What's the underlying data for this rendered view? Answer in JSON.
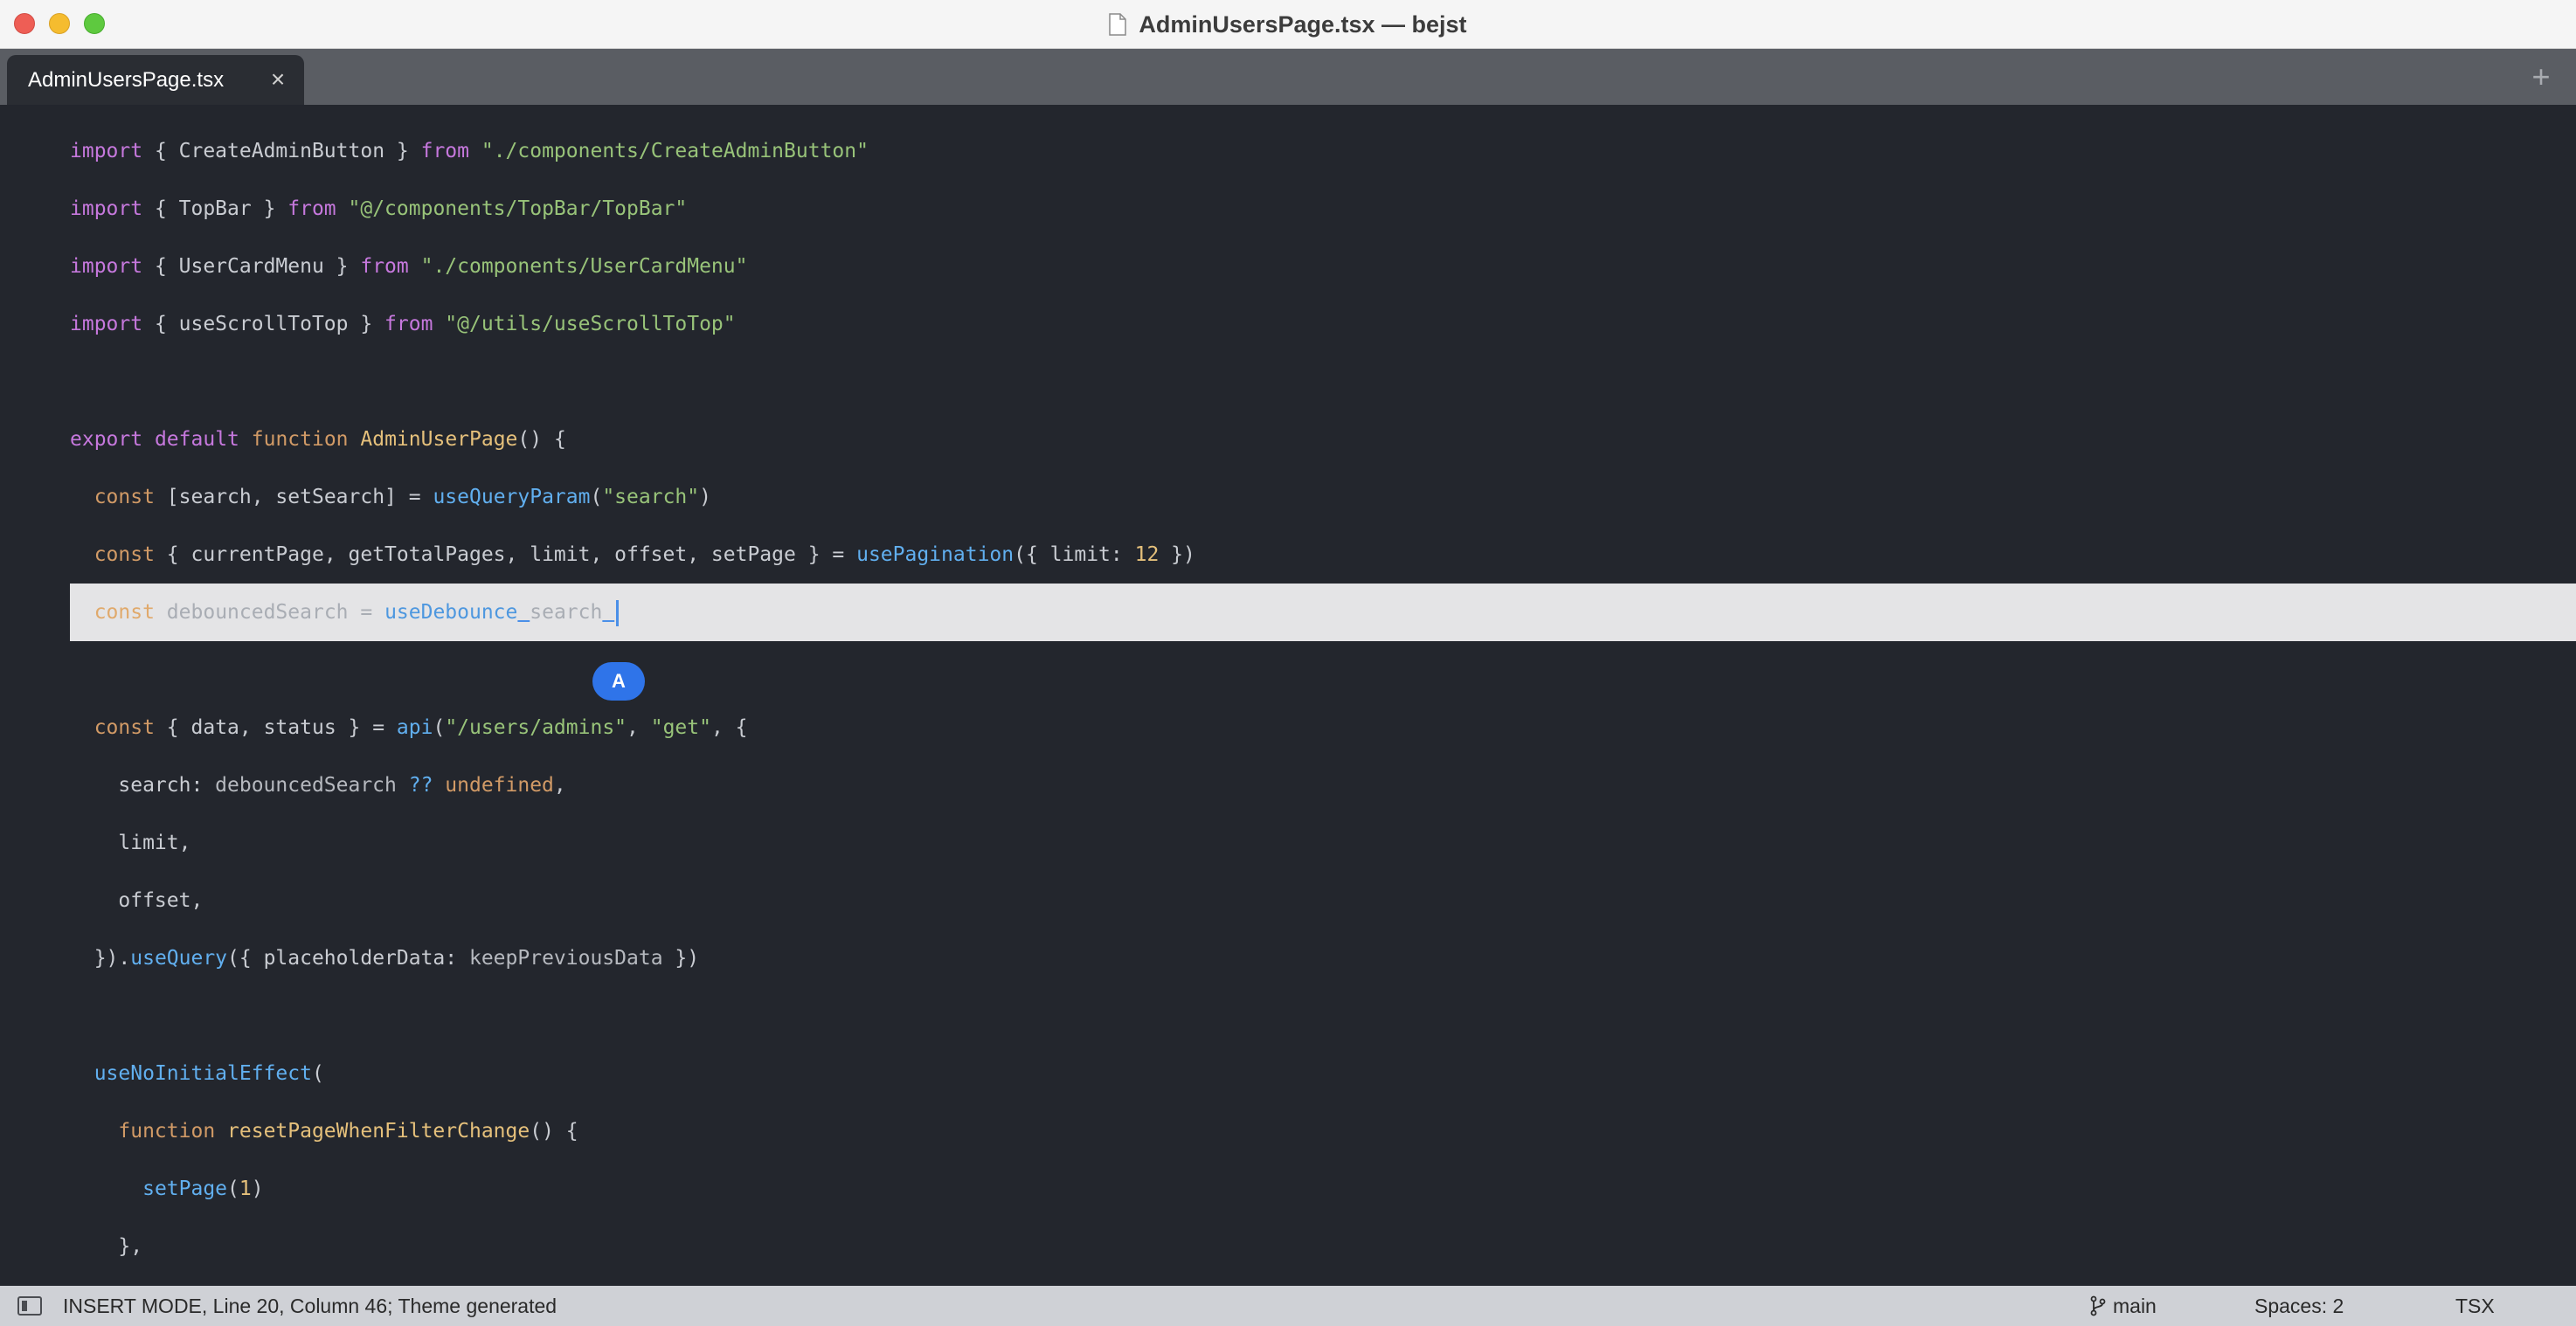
{
  "window": {
    "title": "AdminUsersPage.tsx — bejst"
  },
  "tabs": [
    {
      "label": "AdminUsersPage.tsx",
      "close_glyph": "×"
    }
  ],
  "new_tab_glyph": "+",
  "editor": {
    "lines": [
      {
        "parts": [
          "import",
          " { CreateAdminButton } ",
          "from",
          " ",
          "\"./components/CreateAdminButton\""
        ]
      },
      {
        "parts": [
          "import",
          " { TopBar } ",
          "from",
          " ",
          "\"@/components/TopBar/TopBar\""
        ]
      },
      {
        "parts": [
          "import",
          " { UserCardMenu } ",
          "from",
          " ",
          "\"./components/UserCardMenu\""
        ]
      },
      {
        "parts": [
          "import",
          " { useScrollToTop } ",
          "from",
          " ",
          "\"@/utils/useScrollToTop\""
        ]
      },
      {
        "parts": []
      },
      {
        "parts": [
          "export",
          " ",
          "default",
          " ",
          "function",
          " ",
          "AdminUserPage",
          "() {"
        ]
      },
      {
        "parts": [
          "  ",
          "const",
          " [search, setSearch] = ",
          "useQueryParam",
          "(",
          "\"search\"",
          ")"
        ]
      },
      {
        "parts": [
          "  ",
          "const",
          " { currentPage, getTotalPages, limit, offset, setPage } = ",
          "usePagination",
          "({ limit: ",
          "12",
          " })"
        ]
      },
      {
        "parts": [
          "  ",
          "const",
          " debouncedSearch = ",
          "useDebounce",
          " ",
          "search",
          " "
        ]
      },
      {
        "parts": []
      },
      {
        "parts": [
          "  ",
          "const",
          " { data, status } = ",
          "api",
          "(",
          "\"/users/admins\"",
          ", ",
          "\"get\"",
          ", {"
        ]
      },
      {
        "parts": [
          "    search: ",
          "debouncedSearch",
          " ?? ",
          "undefined",
          ","
        ]
      },
      {
        "parts": [
          "    limit,"
        ]
      },
      {
        "parts": [
          "    offset,"
        ]
      },
      {
        "parts": [
          "  }).",
          "useQuery",
          "({ placeholderData: ",
          "keepPreviousData",
          " })"
        ]
      },
      {
        "parts": []
      },
      {
        "parts": [
          "  ",
          "useNoInitialEffect",
          "("
        ]
      },
      {
        "parts": [
          "    ",
          "function",
          " ",
          "resetPageWhenFilterChange",
          "() {"
        ]
      },
      {
        "parts": [
          "      ",
          "setPage",
          "(",
          "1",
          ")"
        ]
      },
      {
        "parts": [
          "    },"
        ]
      }
    ],
    "ime_badge": "A"
  },
  "statusbar": {
    "mode_text": "INSERT MODE, Line 20, Column 46; Theme generated",
    "branch": "main",
    "spaces": "Spaces: 2",
    "syntax": "TSX"
  },
  "colors": {
    "keyword": "#c678dd",
    "storage": "#d19a66",
    "function_name": "#e5c07b",
    "string": "#98c379",
    "call": "#61afef",
    "number": "#e5c07b",
    "editor_bg": "#23262d",
    "current_line_bg": "#e4e4e6",
    "caret": "#4a8fe8"
  }
}
